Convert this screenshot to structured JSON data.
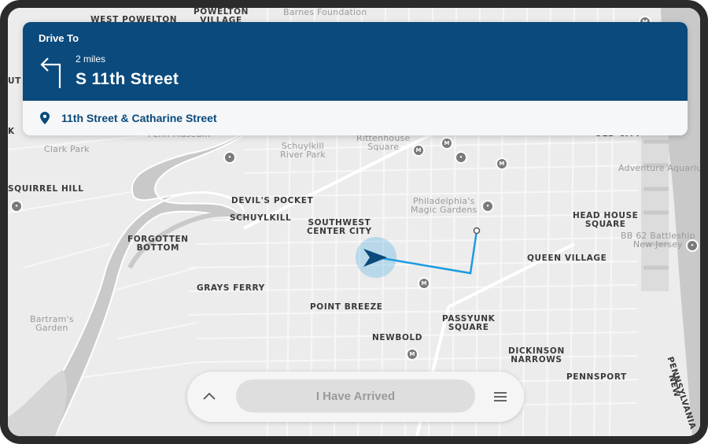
{
  "navigation": {
    "heading": "Drive To",
    "turn_icon": "turn-left-icon",
    "distance": "2 miles",
    "street": "S 11th Street",
    "destination_icon": "location-pin-icon",
    "destination": "11th Street & Catharine Street"
  },
  "map": {
    "labels": {
      "west_powelton": "WEST POWELTON",
      "powelton_village": "POWELTON\nVILLAGE",
      "barnes_foundation": "Barnes Foundation",
      "ut": "UT",
      "k": "K",
      "penn_museum": "Penn Museum",
      "clark_park": "Clark Park",
      "schuylkill_river_park": "Schuylkill\nRiver Park",
      "rittenhouse_square": "Rittenhouse\nSquare",
      "old_city": "OLD CITY",
      "adventure_aquarium": "Adventure Aquariu",
      "squirrel_hill": "SQUIRREL HILL",
      "devils_pocket": "DEVIL'S POCKET",
      "schuylkill": "SCHUYLKILL",
      "philadelphias_magic_gardens": "Philadelphia's\nMagic Gardens",
      "southwest_center_city": "SOUTHWEST\nCENTER CITY",
      "head_house_square": "HEAD HOUSE\nSQUARE",
      "bb62_battleship": "BB 62 Battleship\nNew Jersey",
      "forgotten_bottom": "FORGOTTEN\nBOTTOM",
      "queen_village": "QUEEN VILLAGE",
      "grays_ferry": "GRAYS FERRY",
      "point_breeze": "POINT BREEZE",
      "passyunk_square": "PASSYUNK\nSQUARE",
      "bartrams_garden": "Bartram's\nGarden",
      "newbold": "NEWBOLD",
      "dickinson_narrows": "DICKINSON\nNARROWS",
      "pennsport": "PENNSPORT",
      "pennsylvania": "PENNSYLVANIA",
      "new": "NEW"
    },
    "route_color": "#1a9be0",
    "vehicle_color": "#0a4a7c"
  },
  "bottom_bar": {
    "expand_icon": "chevron-up-icon",
    "arrived_label": "I Have Arrived",
    "menu_icon": "hamburger-menu-icon"
  },
  "colors": {
    "header_bg": "#0a4a7c",
    "map_bg": "#ececec",
    "water": "#c9c9c9"
  }
}
